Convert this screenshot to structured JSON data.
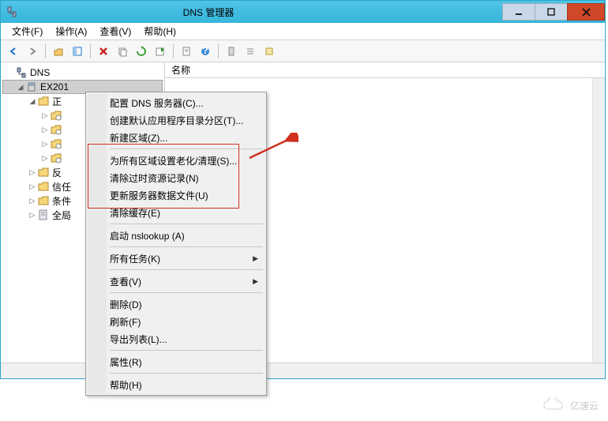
{
  "window": {
    "title": "DNS 管理器"
  },
  "menubar": {
    "file": "文件(F)",
    "action": "操作(A)",
    "view": "查看(V)",
    "help": "帮助(H)"
  },
  "list": {
    "header_name": "名称"
  },
  "tree": {
    "root": "DNS",
    "server": "EX201",
    "forward": "正",
    "sub_items": [
      "",
      "",
      "",
      ""
    ],
    "reverse": "反",
    "trust": "信任",
    "condition": "条件",
    "global": "全局"
  },
  "context_menu": {
    "configure_dns": "配置 DNS 服务器(C)...",
    "create_default_partition": "创建默认应用程序目录分区(T)...",
    "new_zone": "新建区域(Z)...",
    "aging_scavenging": "为所有区域设置老化/清理(S)...",
    "clear_stale": "清除过时资源记录(N)",
    "update_server_data": "更新服务器数据文件(U)",
    "clear_cache": "清除缓存(E)",
    "nslookup": "启动 nslookup (A)",
    "all_tasks": "所有任务(K)",
    "view": "查看(V)",
    "delete": "删除(D)",
    "refresh": "刷新(F)",
    "export_list": "导出列表(L)...",
    "properties": "属性(R)",
    "help": "帮助(H)"
  },
  "watermark": {
    "text": "亿速云"
  }
}
